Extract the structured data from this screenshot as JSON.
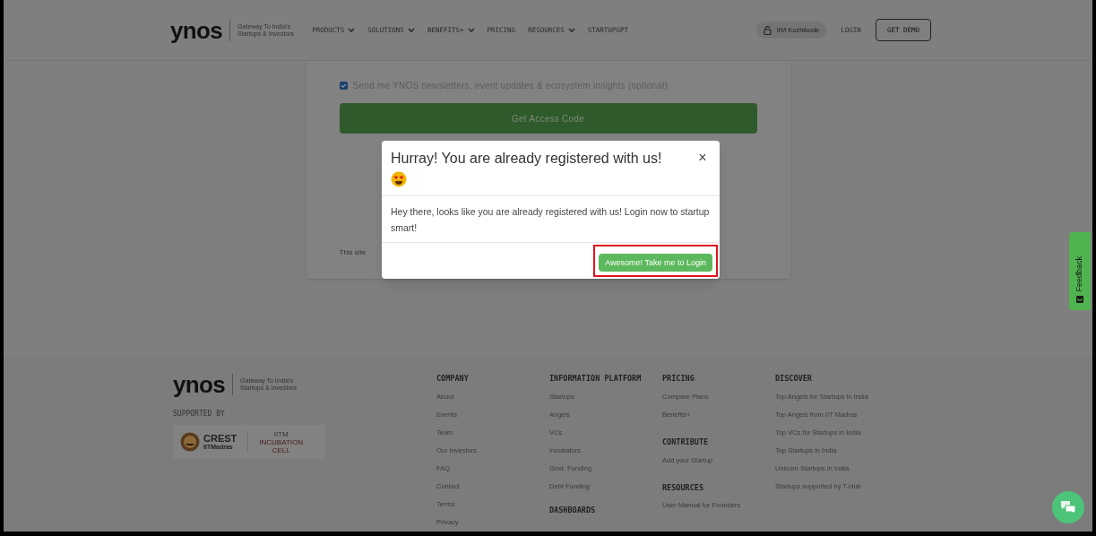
{
  "header": {
    "logo": "ynos",
    "tagline": [
      "Gateway To India's",
      "Startups & Investors"
    ],
    "nav": [
      {
        "label": "PRODUCTS",
        "dropdown": true
      },
      {
        "label": "SOLUTIONS",
        "dropdown": true
      },
      {
        "label": "BENEFITS+",
        "dropdown": true
      },
      {
        "label": "PRICING",
        "dropdown": false
      },
      {
        "label": "RESOURCES",
        "dropdown": true
      },
      {
        "label": "STARTUPGPT",
        "dropdown": false
      }
    ],
    "institution": "IIM Kozhikode",
    "login": "LOGIN",
    "demo": "GET DEMO"
  },
  "form": {
    "newsletter": {
      "label": "Send me YNOS newsletters, event updates & ecosystem insights (optional)",
      "checked": true
    },
    "submit": "Get Access Code",
    "footnote": "This site"
  },
  "modal": {
    "title": "Hurray! You are already registered with us!",
    "close": "×",
    "body": "Hey there, looks like you are already registered with us! Login now to startup smart!",
    "button": "Awesome! Take me to Login"
  },
  "feedback": "Feedback",
  "footer": {
    "logo": "ynos",
    "tagline": [
      "Gateway To India's",
      "Startups & Investors"
    ],
    "supported_by": "SUPPORTED BY",
    "partners": {
      "crest": [
        "CREST",
        "IITMadras"
      ],
      "incubation": [
        "IITM",
        "INCUBATION",
        "CELL"
      ]
    },
    "columns": [
      [
        {
          "heading": "COMPANY",
          "links": [
            "About",
            "Events",
            "Team",
            "Our Investors",
            "FAQ",
            "Contact",
            "Terms",
            "Privacy"
          ]
        }
      ],
      [
        {
          "heading": "INFORMATION PLATFORM",
          "links": [
            "Startups",
            "Angels",
            "VCs",
            "Incubators",
            "Govt. Funding",
            "Debt Funding"
          ]
        },
        {
          "heading": "DASHBOARDS"
        }
      ],
      [
        {
          "heading": "PRICING",
          "links": [
            "Compare Plans",
            "Benefits+"
          ]
        },
        {
          "heading": "CONTRIBUTE",
          "links": [
            "Add your Startup"
          ]
        },
        {
          "heading": "RESOURCES",
          "links": [
            "User Manual for Founders"
          ]
        }
      ],
      [
        {
          "heading": "DISCOVER",
          "links": [
            "Top Angels for Startups in India",
            "Top Angels from IIT Madras",
            "Top VCs for Startups in India",
            "Top Startups in India",
            "Unicorn Startups in India",
            "Startups supported by T-Hub"
          ]
        }
      ]
    ]
  }
}
